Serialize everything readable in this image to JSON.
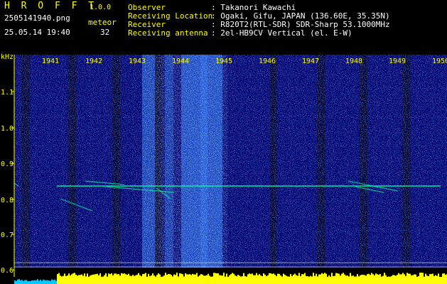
{
  "app": {
    "name": "H R O F F T",
    "version": "1.0.0"
  },
  "file": {
    "name": "2505141940.png",
    "datetime": "25.05.14 19:40"
  },
  "meteor": {
    "label": "meteor",
    "count": "32"
  },
  "info": [
    {
      "label": "Observer",
      "value": ": Takanori Kawachi"
    },
    {
      "label": "Receiving Location",
      "value": ": Ogaki, Gifu, JAPAN (136.60E, 35.35N)"
    },
    {
      "label": "Receiver",
      "value": ": R820T2(RTL-SDR) SDR-Sharp 53.1000MHz"
    },
    {
      "label": "Receiving antenna",
      "value": ": 2el-HB9CV Vertical (el. E-W)"
    }
  ],
  "spectrogram": {
    "y_unit": "kHz",
    "y_ticks": [
      "1.1",
      "1.0",
      "0.9",
      "0.8",
      "0.7",
      "0.6"
    ],
    "x_ticks": [
      "1941",
      "1942",
      "1943",
      "1944",
      "1945",
      "1946",
      "1947",
      "1948",
      "1949",
      "1950"
    ],
    "colors": {
      "background": "#00006a",
      "noise": "#1f4cff",
      "trace": "#00ffa0",
      "level": "#ffff00",
      "axis": "#ffff00"
    }
  }
}
